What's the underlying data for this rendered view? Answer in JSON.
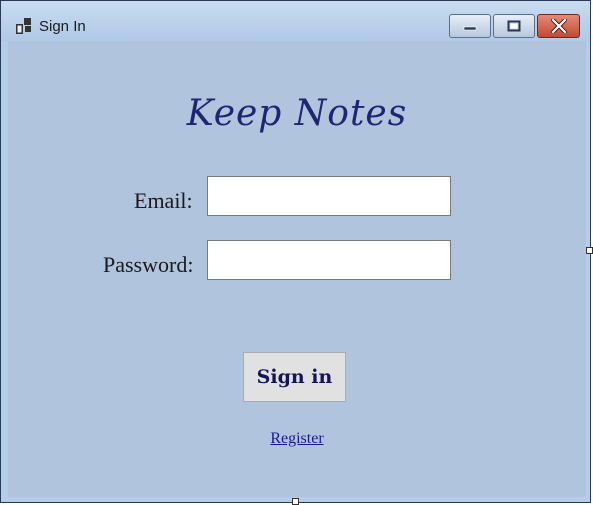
{
  "window": {
    "title": "Sign In",
    "icon": "app-window-icon",
    "controls": [
      "minimize-icon",
      "maximize-icon",
      "close-icon"
    ]
  },
  "form": {
    "app_title": "Keep Notes",
    "email_label": "Email:",
    "email_value": "",
    "password_label": "Password:",
    "password_value": "",
    "signin_label": "Sign in",
    "register_label": "Register"
  },
  "colors": {
    "background": "#b0c4de",
    "title_color": "#1e2572",
    "link_color": "#1a1a8c"
  }
}
